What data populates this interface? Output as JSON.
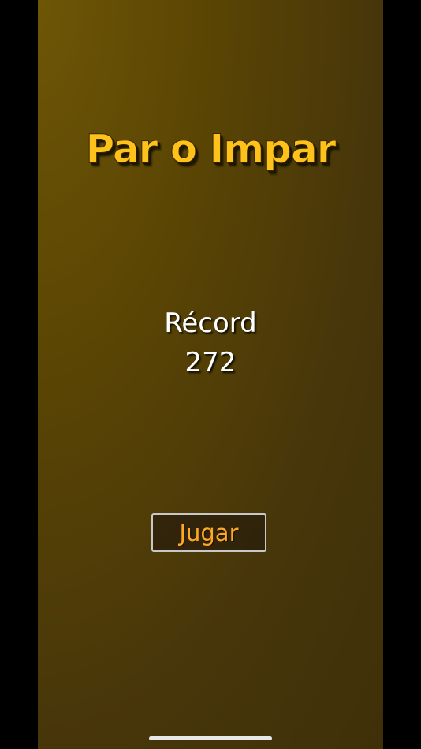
{
  "app": {
    "title": "Par o Impar"
  },
  "record": {
    "label": "Récord",
    "value": "272"
  },
  "buttons": {
    "play_label": "Jugar"
  },
  "colors": {
    "background_top": "#6e5606",
    "background_bottom": "#3f3009",
    "title": "#ffc21a",
    "play_text": "#ffa726",
    "text": "#ffffff"
  }
}
